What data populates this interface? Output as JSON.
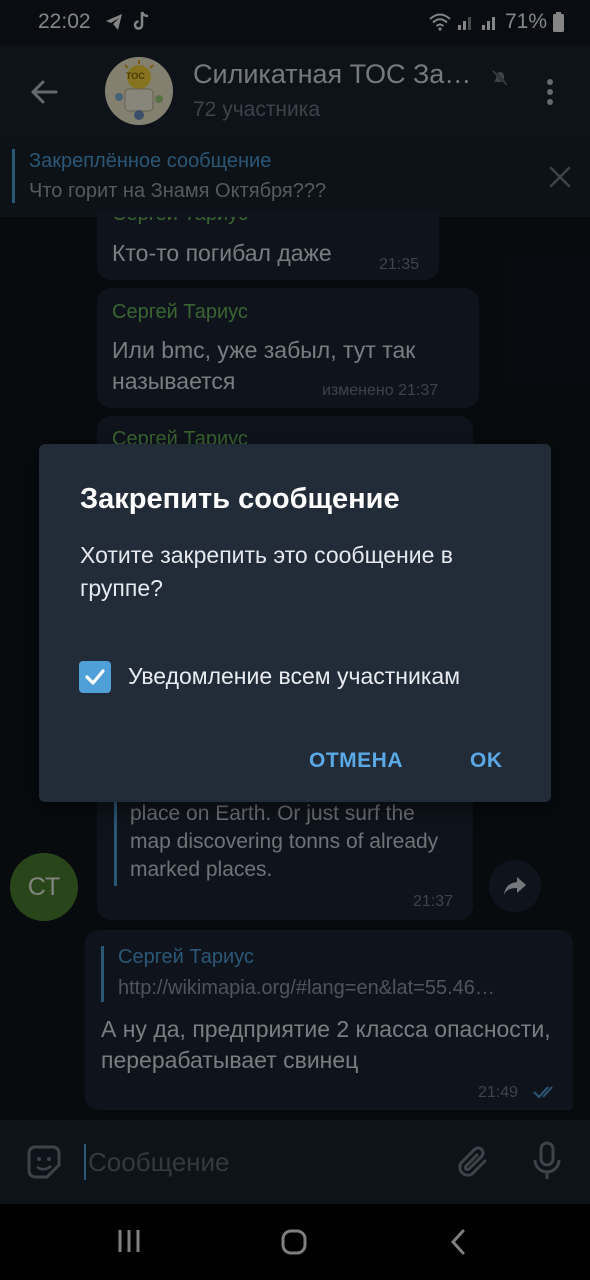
{
  "status_bar": {
    "time": "22:02",
    "battery": "71%"
  },
  "header": {
    "title": "Силикатная ТОС За…",
    "subtitle": "72 участника",
    "avatar_text": "ТОС"
  },
  "pinned": {
    "title": "Закреплённое сообщение",
    "text": "Что горит на Знамя Октября???"
  },
  "messages": [
    {
      "sender": "Сергей Тариус",
      "text": "Кто-то погибал даже",
      "time": "21:35"
    },
    {
      "sender": "Сергей Тариус",
      "text": "Или bmc, уже забыл, тут так называется",
      "time": "изменено 21:37"
    },
    {
      "sender": "Сергей Тариус",
      "text": "",
      "time": ""
    },
    {
      "sender": "",
      "text": "place on Earth. Or just surf the map discovering tonns of already marked places.",
      "time": "21:37"
    }
  ],
  "sender_avatar": "СТ",
  "reply_message": {
    "quote_sender": "Сергей Тариус",
    "quote_text": "http://wikimapia.org/#lang=en&lat=55.46…",
    "text": "А ну да, предприятие 2 класса опасности, перерабатывает свинец",
    "time": "21:49"
  },
  "dialog": {
    "title": "Закрепить сообщение",
    "text": "Хотите закрепить это сообщение в группе?",
    "checkbox_label": "Уведомление всем участникам",
    "checkbox_checked": true,
    "cancel": "ОТМЕНА",
    "ok": "OK"
  },
  "composer": {
    "placeholder": "Сообщение"
  },
  "colors": {
    "accent": "#4f9fd8",
    "sender_green": "#6ab75a",
    "bubble": "#1c2633",
    "header": "#1b2430"
  }
}
